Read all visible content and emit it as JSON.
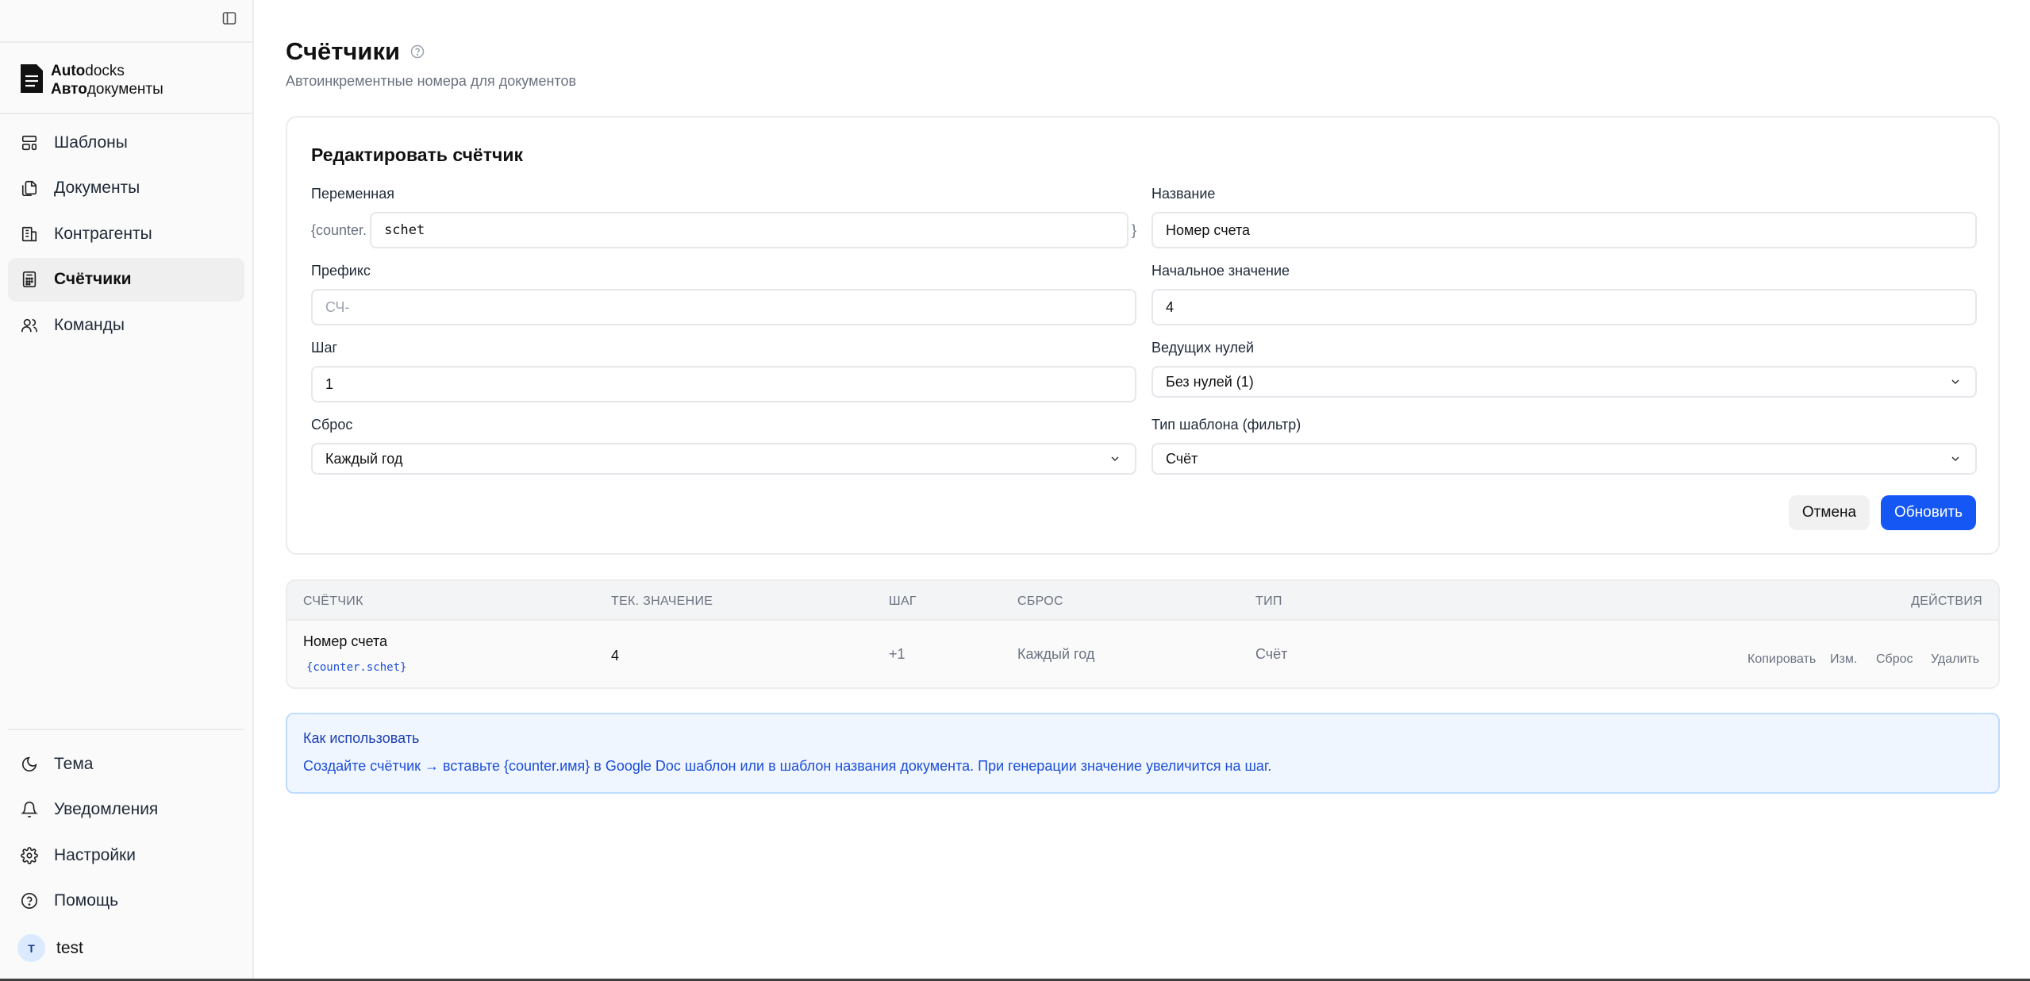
{
  "app": {
    "logo_line1_bold": "Auto",
    "logo_line1_rest": "docks",
    "logo_line2_bold": "Авто",
    "logo_line2_rest": "документы"
  },
  "sidebar": {
    "nav": [
      {
        "label": "Шаблоны",
        "icon": "layout-template-icon"
      },
      {
        "label": "Документы",
        "icon": "files-icon"
      },
      {
        "label": "Контрагенты",
        "icon": "building-icon"
      },
      {
        "label": "Счётчики",
        "icon": "calculator-icon",
        "active": true
      },
      {
        "label": "Команды",
        "icon": "users-icon"
      }
    ],
    "bottom": [
      {
        "label": "Тема",
        "icon": "moon-icon"
      },
      {
        "label": "Уведомления",
        "icon": "bell-icon"
      },
      {
        "label": "Настройки",
        "icon": "gear-icon"
      },
      {
        "label": "Помощь",
        "icon": "help-circle-icon"
      }
    ],
    "user": {
      "initial": "T",
      "name": "test"
    }
  },
  "page": {
    "title": "Счётчики",
    "subtitle": "Автоинкрементные номера для документов"
  },
  "form": {
    "title": "Редактировать счётчик",
    "variable": {
      "label": "Переменная",
      "prefix": "{counter.",
      "value": "schet",
      "suffix": "}"
    },
    "name": {
      "label": "Название",
      "value": "Номер счета"
    },
    "prefix": {
      "label": "Префикс",
      "placeholder": "СЧ-"
    },
    "start": {
      "label": "Начальное значение",
      "value": "4"
    },
    "step": {
      "label": "Шаг",
      "value": "1"
    },
    "zeros": {
      "label": "Ведущих нулей",
      "value": "Без нулей (1)"
    },
    "reset": {
      "label": "Сброс",
      "value": "Каждый год"
    },
    "template_type": {
      "label": "Тип шаблона (фильтр)",
      "value": "Счёт"
    },
    "cancel_label": "Отмена",
    "update_label": "Обновить"
  },
  "table": {
    "headers": {
      "counter": "СЧЁТЧИК",
      "current": "ТЕК. ЗНАЧЕНИЕ",
      "step": "ШАГ",
      "reset": "СБРОС",
      "type": "ТИП",
      "actions": "ДЕЙСТВИЯ"
    },
    "rows": [
      {
        "name": "Номер счета",
        "code": "{counter.schet}",
        "current": "4",
        "step": "+1",
        "reset": "Каждый год",
        "type": "Счёт",
        "actions": {
          "copy": "Копировать",
          "edit": "Изм.",
          "reset": "Сброс",
          "delete": "Удалить"
        }
      }
    ]
  },
  "info": {
    "title": "Как использовать",
    "text": "Создайте счётчик → вставьте {counter.имя} в Google Doc шаблон или в шаблон названия документа. При генерации значение увеличится на шаг."
  }
}
